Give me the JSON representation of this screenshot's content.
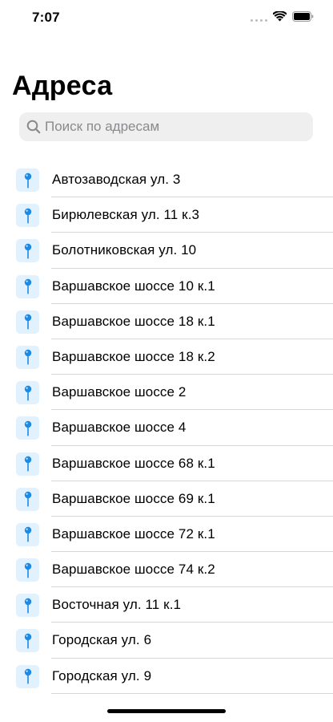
{
  "status_bar": {
    "time": "7:07"
  },
  "header": {
    "title": "Адреса"
  },
  "search": {
    "placeholder": "Поиск по адресам",
    "value": ""
  },
  "colors": {
    "pin_blue": "#1a8ae6",
    "pin_background": "#e1f1fd",
    "search_background": "#efeff0",
    "placeholder_gray": "#8a8a8e"
  },
  "icons": {
    "search": "magnifying-glass",
    "item": "map-pin"
  },
  "addresses": [
    {
      "label": "Автозаводская ул. 3"
    },
    {
      "label": "Бирюлевская ул. 11 к.3"
    },
    {
      "label": "Болотниковская ул. 10"
    },
    {
      "label": "Варшавское шоссе 10 к.1"
    },
    {
      "label": "Варшавское шоссе 18 к.1"
    },
    {
      "label": "Варшавское шоссе 18 к.2"
    },
    {
      "label": "Варшавское шоссе 2"
    },
    {
      "label": "Варшавское шоссе 4"
    },
    {
      "label": "Варшавское шоссе 68 к.1"
    },
    {
      "label": "Варшавское шоссе 69 к.1"
    },
    {
      "label": "Варшавское шоссе 72 к.1"
    },
    {
      "label": "Варшавское шоссе 74 к.2"
    },
    {
      "label": "Восточная ул. 11 к.1"
    },
    {
      "label": "Городская ул. 6"
    },
    {
      "label": "Городская ул. 9"
    }
  ]
}
